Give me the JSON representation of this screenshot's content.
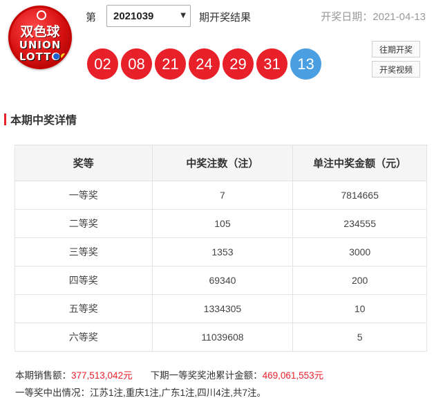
{
  "header": {
    "logo": {
      "cn": "双色球",
      "en_line1": "UNION",
      "en_line2": "LOTTO"
    },
    "issue_prefix": "第",
    "issue_selected": "2021039",
    "issue_suffix": "期开奖结果",
    "draw_date": "开奖日期：2021-04-13"
  },
  "balls": {
    "red": [
      "02",
      "08",
      "21",
      "24",
      "29",
      "31"
    ],
    "blue": [
      "13"
    ]
  },
  "side_buttons": {
    "history": "往期开奖",
    "video": "开奖视频"
  },
  "section": {
    "title": "本期中奖详情"
  },
  "table": {
    "headers": [
      "奖等",
      "中奖注数（注）",
      "单注中奖金额（元）"
    ],
    "rows": [
      [
        "一等奖",
        "7",
        "7814665"
      ],
      [
        "二等奖",
        "105",
        "234555"
      ],
      [
        "三等奖",
        "1353",
        "3000"
      ],
      [
        "四等奖",
        "69340",
        "200"
      ],
      [
        "五等奖",
        "1334305",
        "10"
      ],
      [
        "六等奖",
        "11039608",
        "5"
      ]
    ]
  },
  "footer": {
    "sales_label": "本期销售额：",
    "sales_value": "377,513,042元",
    "pool_label": "下期一等奖奖池累计金额：",
    "pool_value": "469,061,553元",
    "winners_info": "一等奖中出情况：江苏1注,重庆1注,广东1注,四川4注,共7注。"
  },
  "colors": {
    "red_ball": "#e8202a",
    "blue_ball": "#4a9fe3",
    "accent": "#e8202a"
  }
}
